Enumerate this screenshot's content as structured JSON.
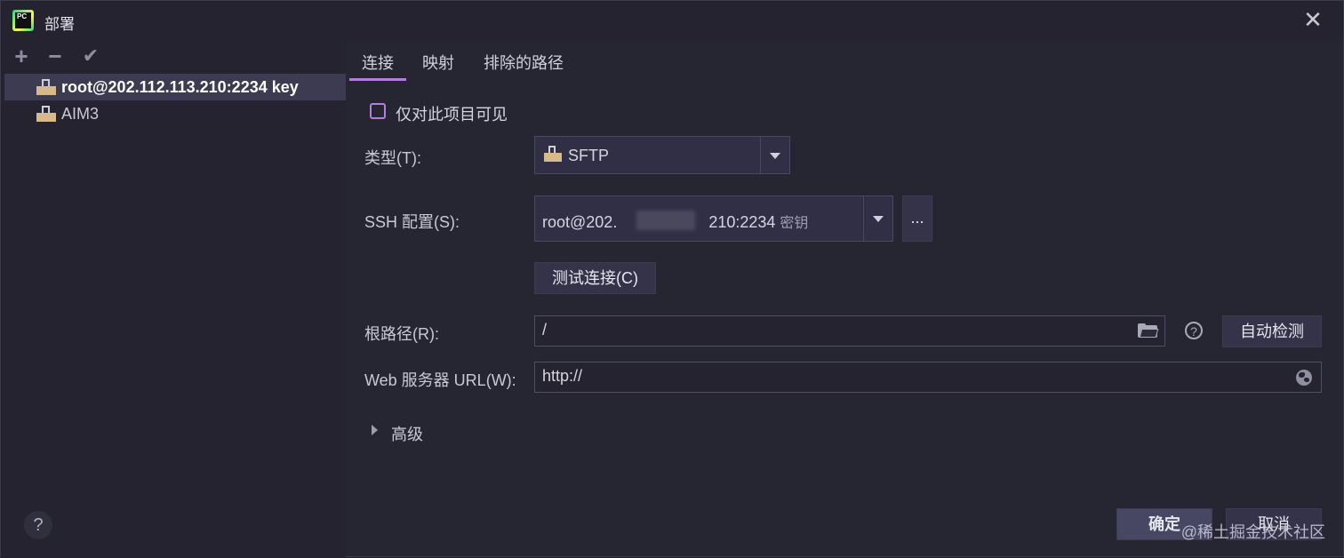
{
  "window": {
    "title": "部署"
  },
  "toolbar": {
    "add": "+",
    "remove": "−",
    "apply": "✔"
  },
  "servers": [
    {
      "label": "root@202.112.113.210:2234 key",
      "selected": true
    },
    {
      "label": "AIM3",
      "selected": false
    }
  ],
  "tabs": [
    {
      "label": "连接",
      "active": true
    },
    {
      "label": "映射",
      "active": false
    },
    {
      "label": "排除的路径",
      "active": false
    }
  ],
  "form": {
    "visible_only_label": "仅对此项目可见",
    "type_label": "类型(T):",
    "type_value": "SFTP",
    "ssh_label": "SSH 配置(S):",
    "ssh_value_prefix": "root@202.",
    "ssh_value_suffix": "210:2234",
    "ssh_hint": "密钥",
    "ssh_more": "...",
    "test_button": "测试连接(C)",
    "root_label": "根路径(R):",
    "root_value": "/",
    "autodetect_button": "自动检测",
    "web_label": "Web 服务器 URL(W):",
    "web_value": "http://",
    "advanced_label": "高级"
  },
  "footer": {
    "ok_button": "确定",
    "cancel_button": "取消",
    "help": "?",
    "watermark": "@稀土掘金技术社区"
  },
  "icons": {
    "close": "close-icon",
    "help": "help-icon"
  }
}
